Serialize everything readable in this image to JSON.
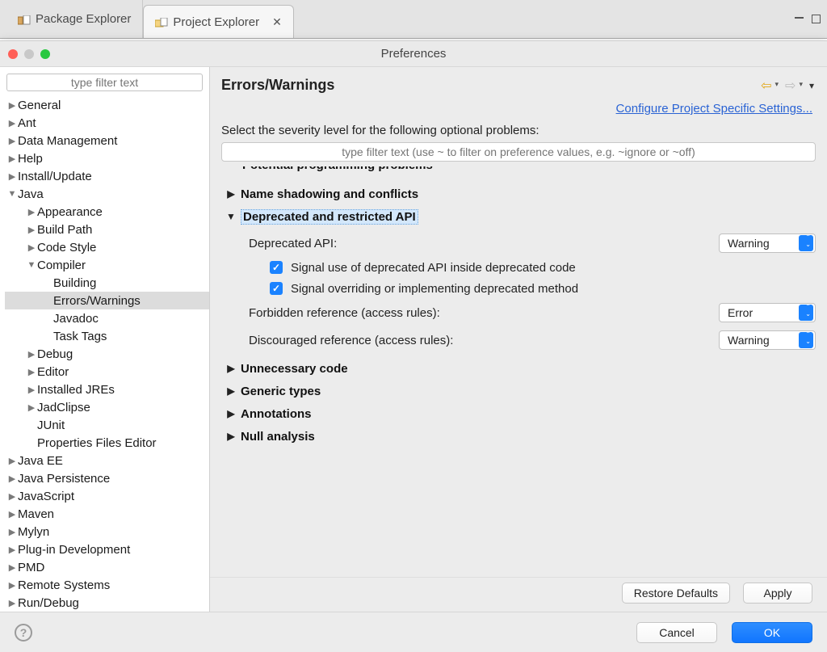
{
  "eclipse_tabs": {
    "package_explorer": "Package Explorer",
    "project_explorer": "Project Explorer"
  },
  "dialog_title": "Preferences",
  "nav_filter_placeholder": "type filter text",
  "tree": {
    "general": "General",
    "ant": "Ant",
    "data_management": "Data Management",
    "help": "Help",
    "install_update": "Install/Update",
    "java": "Java",
    "java_children": {
      "appearance": "Appearance",
      "build_path": "Build Path",
      "code_style": "Code Style",
      "compiler": "Compiler",
      "compiler_children": {
        "building": "Building",
        "errors_warnings": "Errors/Warnings",
        "javadoc": "Javadoc",
        "task_tags": "Task Tags"
      },
      "debug": "Debug",
      "editor": "Editor",
      "installed_jres": "Installed JREs",
      "jadclipse": "JadClipse",
      "junit": "JUnit",
      "properties_editor": "Properties Files Editor"
    },
    "java_ee": "Java EE",
    "java_persistence": "Java Persistence",
    "javascript": "JavaScript",
    "maven": "Maven",
    "mylyn": "Mylyn",
    "plugin_dev": "Plug-in Development",
    "pmd": "PMD",
    "remote_systems": "Remote Systems",
    "run_debug": "Run/Debug"
  },
  "page": {
    "title": "Errors/Warnings",
    "configure_link": "Configure Project Specific Settings...",
    "severity_label": "Select the severity level for the following optional problems:",
    "inner_filter_placeholder": "type filter text (use ~ to filter on preference values, e.g. ~ignore or ~off)",
    "cutoff_group": "Potential programming problems",
    "groups": {
      "name_shadowing": "Name shadowing and conflicts",
      "deprecated_api": "Deprecated and restricted API",
      "unnecessary": "Unnecessary code",
      "generic": "Generic types",
      "annotations": "Annotations",
      "null": "Null analysis"
    },
    "deprecated_section": {
      "deprecated_label": "Deprecated API:",
      "deprecated_value": "Warning",
      "signal_inside": "Signal use of deprecated API inside deprecated code",
      "signal_override": "Signal overriding or implementing deprecated method",
      "forbidden_label": "Forbidden reference (access rules):",
      "forbidden_value": "Error",
      "discouraged_label": "Discouraged reference (access rules):",
      "discouraged_value": "Warning"
    },
    "restore_defaults": "Restore Defaults",
    "apply": "Apply"
  },
  "footer": {
    "cancel": "Cancel",
    "ok": "OK"
  }
}
